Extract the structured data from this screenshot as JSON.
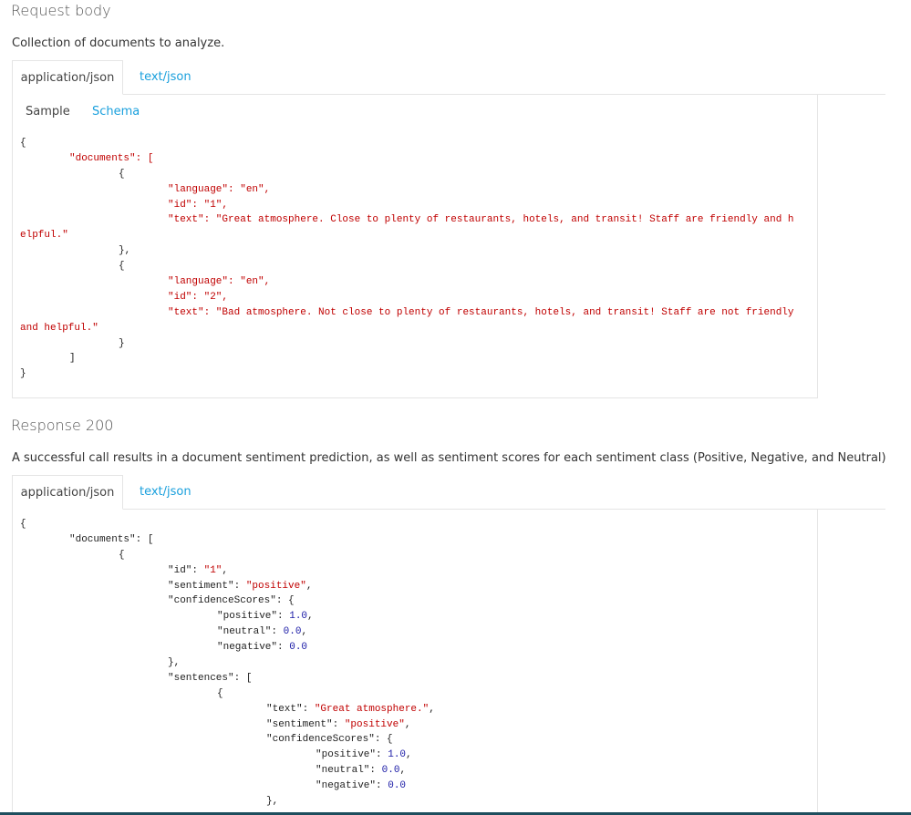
{
  "request": {
    "title": "Request body",
    "description": "Collection of documents to analyze.",
    "tabs": [
      "application/json",
      "text/json"
    ],
    "subtabs": [
      "Sample",
      "Schema"
    ],
    "code": [
      [
        0,
        [
          [
            "{",
            "p"
          ]
        ]
      ],
      [
        1,
        [
          [
            "\"documents\": [",
            "s"
          ]
        ]
      ],
      [
        2,
        [
          [
            "{",
            "p"
          ]
        ]
      ],
      [
        3,
        [
          [
            "\"language\": \"en\",",
            "s"
          ]
        ]
      ],
      [
        3,
        [
          [
            "\"id\": \"1\",",
            "s"
          ]
        ]
      ],
      [
        3,
        [
          [
            "\"text\": \"Great atmosphere. Close to plenty of restaurants, hotels, and transit! Staff are friendly and h",
            "s"
          ]
        ]
      ],
      [
        0,
        [
          [
            "elpful.\"",
            "s"
          ]
        ]
      ],
      [
        2,
        [
          [
            "},",
            "p"
          ]
        ]
      ],
      [
        2,
        [
          [
            "{",
            "p"
          ]
        ]
      ],
      [
        3,
        [
          [
            "\"language\": \"en\",",
            "s"
          ]
        ]
      ],
      [
        3,
        [
          [
            "\"id\": \"2\",",
            "s"
          ]
        ]
      ],
      [
        3,
        [
          [
            "\"text\": \"Bad atmosphere. Not close to plenty of restaurants, hotels, and transit! Staff are not friendly",
            "s"
          ]
        ]
      ],
      [
        0,
        [
          [
            "and helpful.\"",
            "s"
          ]
        ]
      ],
      [
        2,
        [
          [
            "}",
            "p"
          ]
        ]
      ],
      [
        1,
        [
          [
            "]",
            "p"
          ]
        ]
      ],
      [
        0,
        [
          [
            "}",
            "p"
          ]
        ]
      ]
    ]
  },
  "response": {
    "title": "Response 200",
    "description": "A successful call results in a document sentiment prediction, as well as sentiment scores for each sentiment class (Positive, Negative, and Neutral)",
    "tabs": [
      "application/json",
      "text/json"
    ],
    "code": [
      [
        0,
        [
          [
            "{",
            "p"
          ]
        ]
      ],
      [
        1,
        [
          [
            "\"documents\": [",
            "p"
          ]
        ]
      ],
      [
        2,
        [
          [
            "{",
            "p"
          ]
        ]
      ],
      [
        3,
        [
          [
            "\"id\": ",
            "p"
          ],
          [
            "\"1\"",
            "s"
          ],
          [
            ",",
            "p"
          ]
        ]
      ],
      [
        3,
        [
          [
            "\"sentiment\": ",
            "p"
          ],
          [
            "\"positive\"",
            "s"
          ],
          [
            ",",
            "p"
          ]
        ]
      ],
      [
        3,
        [
          [
            "\"confidenceScores\": {",
            "p"
          ]
        ]
      ],
      [
        4,
        [
          [
            "\"positive\": ",
            "p"
          ],
          [
            "1.0",
            "n"
          ],
          [
            ",",
            "p"
          ]
        ]
      ],
      [
        4,
        [
          [
            "\"neutral\": ",
            "p"
          ],
          [
            "0.0",
            "n"
          ],
          [
            ",",
            "p"
          ]
        ]
      ],
      [
        4,
        [
          [
            "\"negative\": ",
            "p"
          ],
          [
            "0.0",
            "n"
          ]
        ]
      ],
      [
        3,
        [
          [
            "},",
            "p"
          ]
        ]
      ],
      [
        3,
        [
          [
            "\"sentences\": [",
            "p"
          ]
        ]
      ],
      [
        4,
        [
          [
            "{",
            "p"
          ]
        ]
      ],
      [
        5,
        [
          [
            "\"text\": ",
            "p"
          ],
          [
            "\"Great atmosphere.\"",
            "s"
          ],
          [
            ",",
            "p"
          ]
        ]
      ],
      [
        5,
        [
          [
            "\"sentiment\": ",
            "p"
          ],
          [
            "\"positive\"",
            "s"
          ],
          [
            ",",
            "p"
          ]
        ]
      ],
      [
        5,
        [
          [
            "\"confidenceScores\": {",
            "p"
          ]
        ]
      ],
      [
        6,
        [
          [
            "\"positive\": ",
            "p"
          ],
          [
            "1.0",
            "n"
          ],
          [
            ",",
            "p"
          ]
        ]
      ],
      [
        6,
        [
          [
            "\"neutral\": ",
            "p"
          ],
          [
            "0.0",
            "n"
          ],
          [
            ",",
            "p"
          ]
        ]
      ],
      [
        6,
        [
          [
            "\"negative\": ",
            "p"
          ],
          [
            "0.0",
            "n"
          ]
        ]
      ],
      [
        5,
        [
          [
            "},",
            "p"
          ]
        ]
      ]
    ]
  }
}
